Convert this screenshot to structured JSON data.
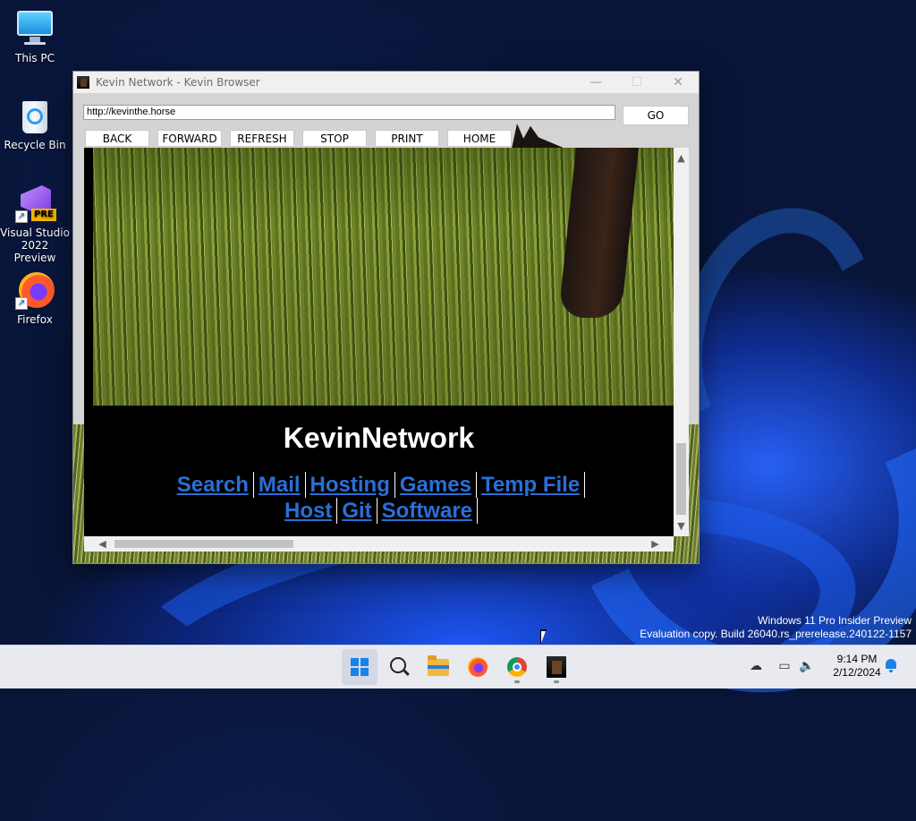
{
  "desktop": {
    "icons": [
      {
        "label": "This PC"
      },
      {
        "label": "Recycle Bin"
      },
      {
        "label": "Visual Studio\n2022 Preview"
      },
      {
        "label": "Firefox"
      }
    ],
    "vs_badge": "PRE"
  },
  "window": {
    "title": "Kevin Network - Kevin Browser",
    "controls": {
      "minimize": "—",
      "maximize": "☐",
      "close": "✕"
    },
    "address": "http://kevinthe.horse",
    "go_label": "GO",
    "nav": {
      "back": "BACK",
      "forward": "FORWARD",
      "refresh": "REFRESH",
      "stop": "STOP",
      "print": "PRINT",
      "home": "HOME"
    }
  },
  "page": {
    "site_title": "KevinNetwork",
    "links": [
      "Search",
      "Mail",
      "Hosting",
      "Games",
      "Temp File",
      "Host",
      "Git",
      "Software"
    ]
  },
  "scrollbars": {
    "up": "▲",
    "down": "▼",
    "left": "◀",
    "right": "▶"
  },
  "watermark": {
    "line1": "Windows 11 Pro Insider Preview",
    "line2": "Evaluation copy. Build 26040.rs_prerelease.240122-1157"
  },
  "taskbar": {
    "apps": [
      "start-icon",
      "search-icon",
      "file-explorer-icon",
      "firefox-icon",
      "chrome-icon",
      "kevin-browser-icon"
    ],
    "time": "9:14 PM",
    "date": "2/12/2024"
  }
}
